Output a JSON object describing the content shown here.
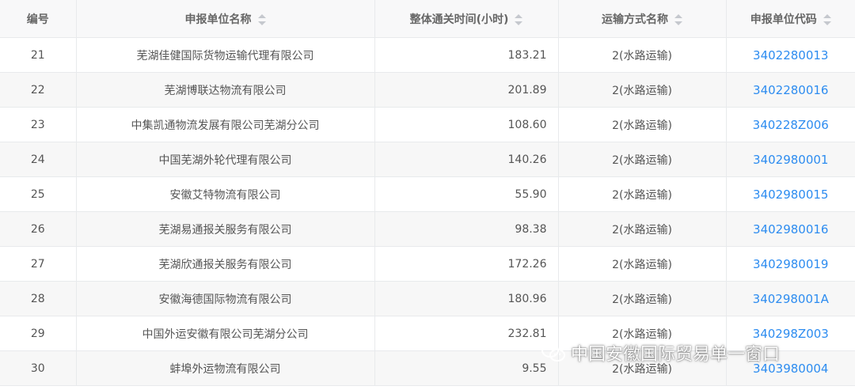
{
  "headers": {
    "id": "编号",
    "name": "申报单位名称",
    "time": "整体通关时间(小时)",
    "transport": "运输方式名称",
    "code": "申报单位代码"
  },
  "rows": [
    {
      "id": "21",
      "name": "芜湖佳健国际货物运输代理有限公司",
      "time": "183.21",
      "transport": "2(水路运输)",
      "code": "3402280013"
    },
    {
      "id": "22",
      "name": "芜湖博联达物流有限公司",
      "time": "201.89",
      "transport": "2(水路运输)",
      "code": "3402280016"
    },
    {
      "id": "23",
      "name": "中集凯通物流发展有限公司芜湖分公司",
      "time": "108.60",
      "transport": "2(水路运输)",
      "code": "340228Z006"
    },
    {
      "id": "24",
      "name": "中国芜湖外轮代理有限公司",
      "time": "140.26",
      "transport": "2(水路运输)",
      "code": "3402980001"
    },
    {
      "id": "25",
      "name": "安徽艾特物流有限公司",
      "time": "55.90",
      "transport": "2(水路运输)",
      "code": "3402980015"
    },
    {
      "id": "26",
      "name": "芜湖易通报关服务有限公司",
      "time": "98.38",
      "transport": "2(水路运输)",
      "code": "3402980016"
    },
    {
      "id": "27",
      "name": "芜湖欣通报关服务有限公司",
      "time": "172.26",
      "transport": "2(水路运输)",
      "code": "3402980019"
    },
    {
      "id": "28",
      "name": "安徽海德国际物流有限公司",
      "time": "180.96",
      "transport": "2(水路运输)",
      "code": "340298001A"
    },
    {
      "id": "29",
      "name": "中国外运安徽有限公司芜湖分公司",
      "time": "232.81",
      "transport": "2(水路运输)",
      "code": "340298Z003"
    },
    {
      "id": "30",
      "name": "蚌埠外运物流有限公司",
      "time": "9.55",
      "transport": "2(水路运输)",
      "code": "3403980004"
    }
  ],
  "watermark": {
    "text": "中国安徽国际贸易单一窗口",
    "icon": "wechat-icon"
  },
  "colors": {
    "link": "#2d8cf0",
    "header_bg": "#f8f8f9",
    "stripe_bg": "#f7f7f7"
  }
}
